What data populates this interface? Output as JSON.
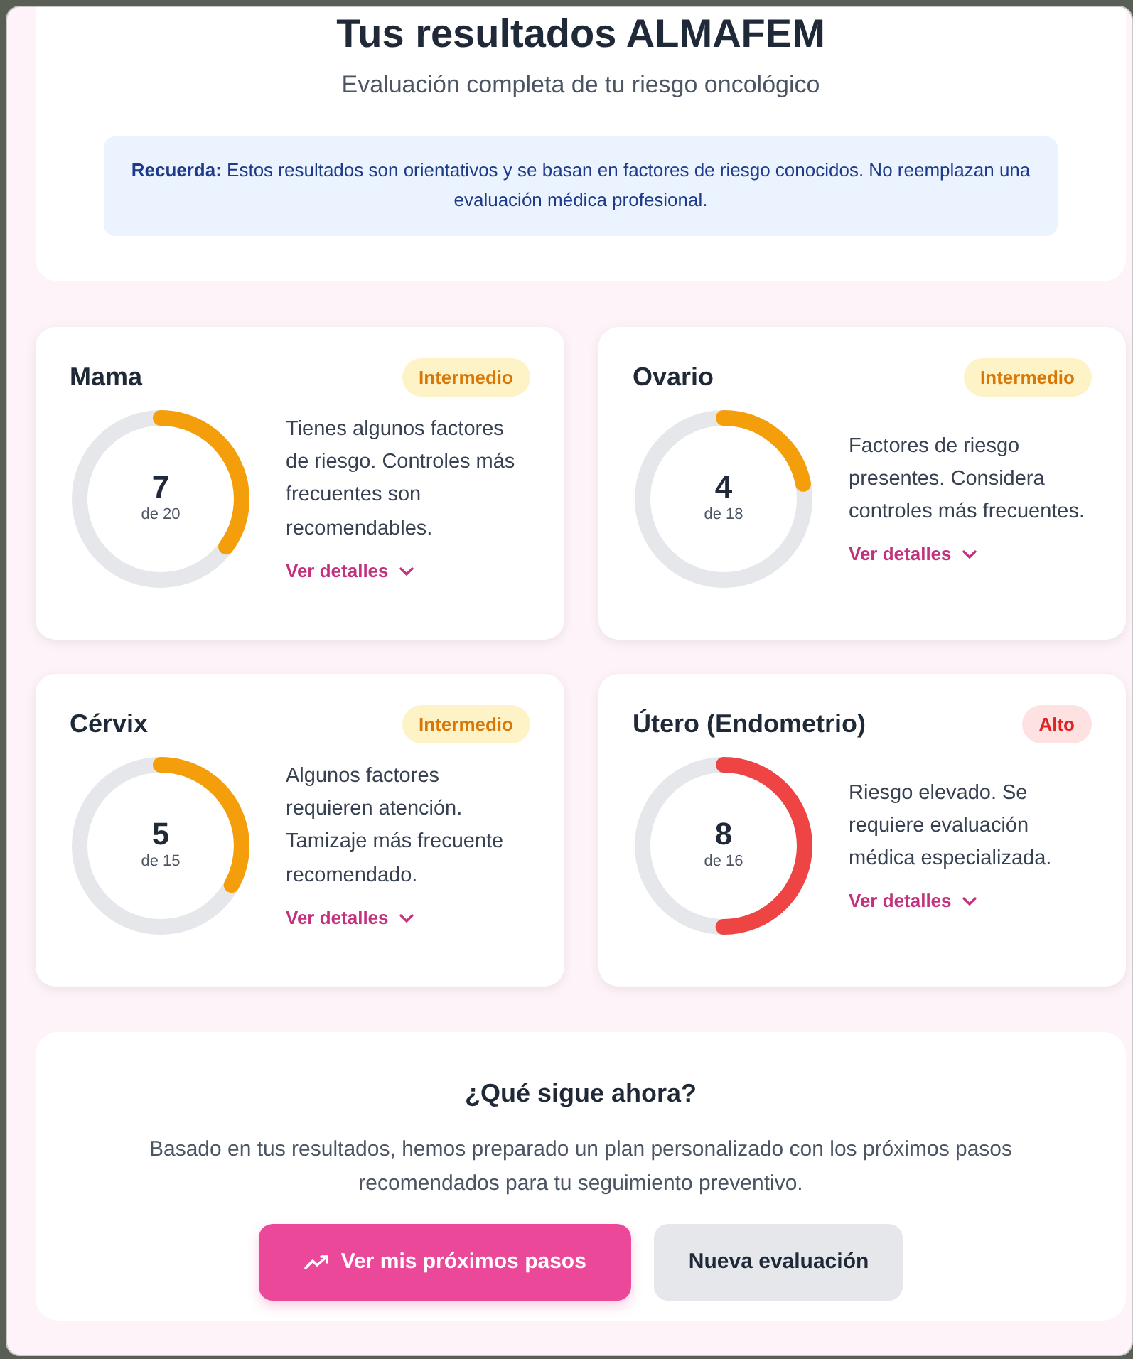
{
  "header": {
    "title": "Tus resultados ALMAFEM",
    "subtitle": "Evaluación completa de tu riesgo oncológico",
    "notice": "**Recuerda:** Estos resultados son orientativos y se basan en factores de riesgo conocidos. No reemplazan una evaluación médica profesional."
  },
  "results": [
    {
      "name": "Mama",
      "kind": "intermedio",
      "badge": "Intermedio",
      "score": "7",
      "max": "de 20",
      "level": 0.35,
      "text": "Tienes algunos factores de riesgo. Controles más frecuentes son recomendables.",
      "link": "Ver detalles"
    },
    {
      "name": "Ovario",
      "kind": "intermedio",
      "badge": "Intermedio",
      "score": "4",
      "max": "de 18",
      "level": 0.22,
      "text": "Factores de riesgo presentes. Considera controles más frecuentes.",
      "link": "Ver detalles"
    },
    {
      "name": "Cérvix",
      "kind": "intermedio",
      "badge": "Intermedio",
      "score": "5",
      "max": "de 15",
      "level": 0.33,
      "text": "Algunos factores requieren atención. Tamizaje más frecuente recomendado.",
      "link": "Ver detalles"
    },
    {
      "name": "Útero (Endometrio)",
      "kind": "alto",
      "badge": "Alto",
      "score": "8",
      "max": "de 16",
      "level": 0.5,
      "text": "Riesgo elevado. Se requiere evaluación médica especializada.",
      "link": "Ver detalles"
    }
  ],
  "next": {
    "title": "¿Qué sigue ahora?",
    "text": "Basado en tus resultados, hemos preparado un plan personalizado con los próximos pasos recomendados para tu seguimiento preventivo.",
    "buttons": [
      {
        "label": "Ver mis próximos pasos",
        "kind": "primary"
      },
      {
        "label": "Nueva evaluación",
        "kind": "secondary"
      }
    ]
  }
}
